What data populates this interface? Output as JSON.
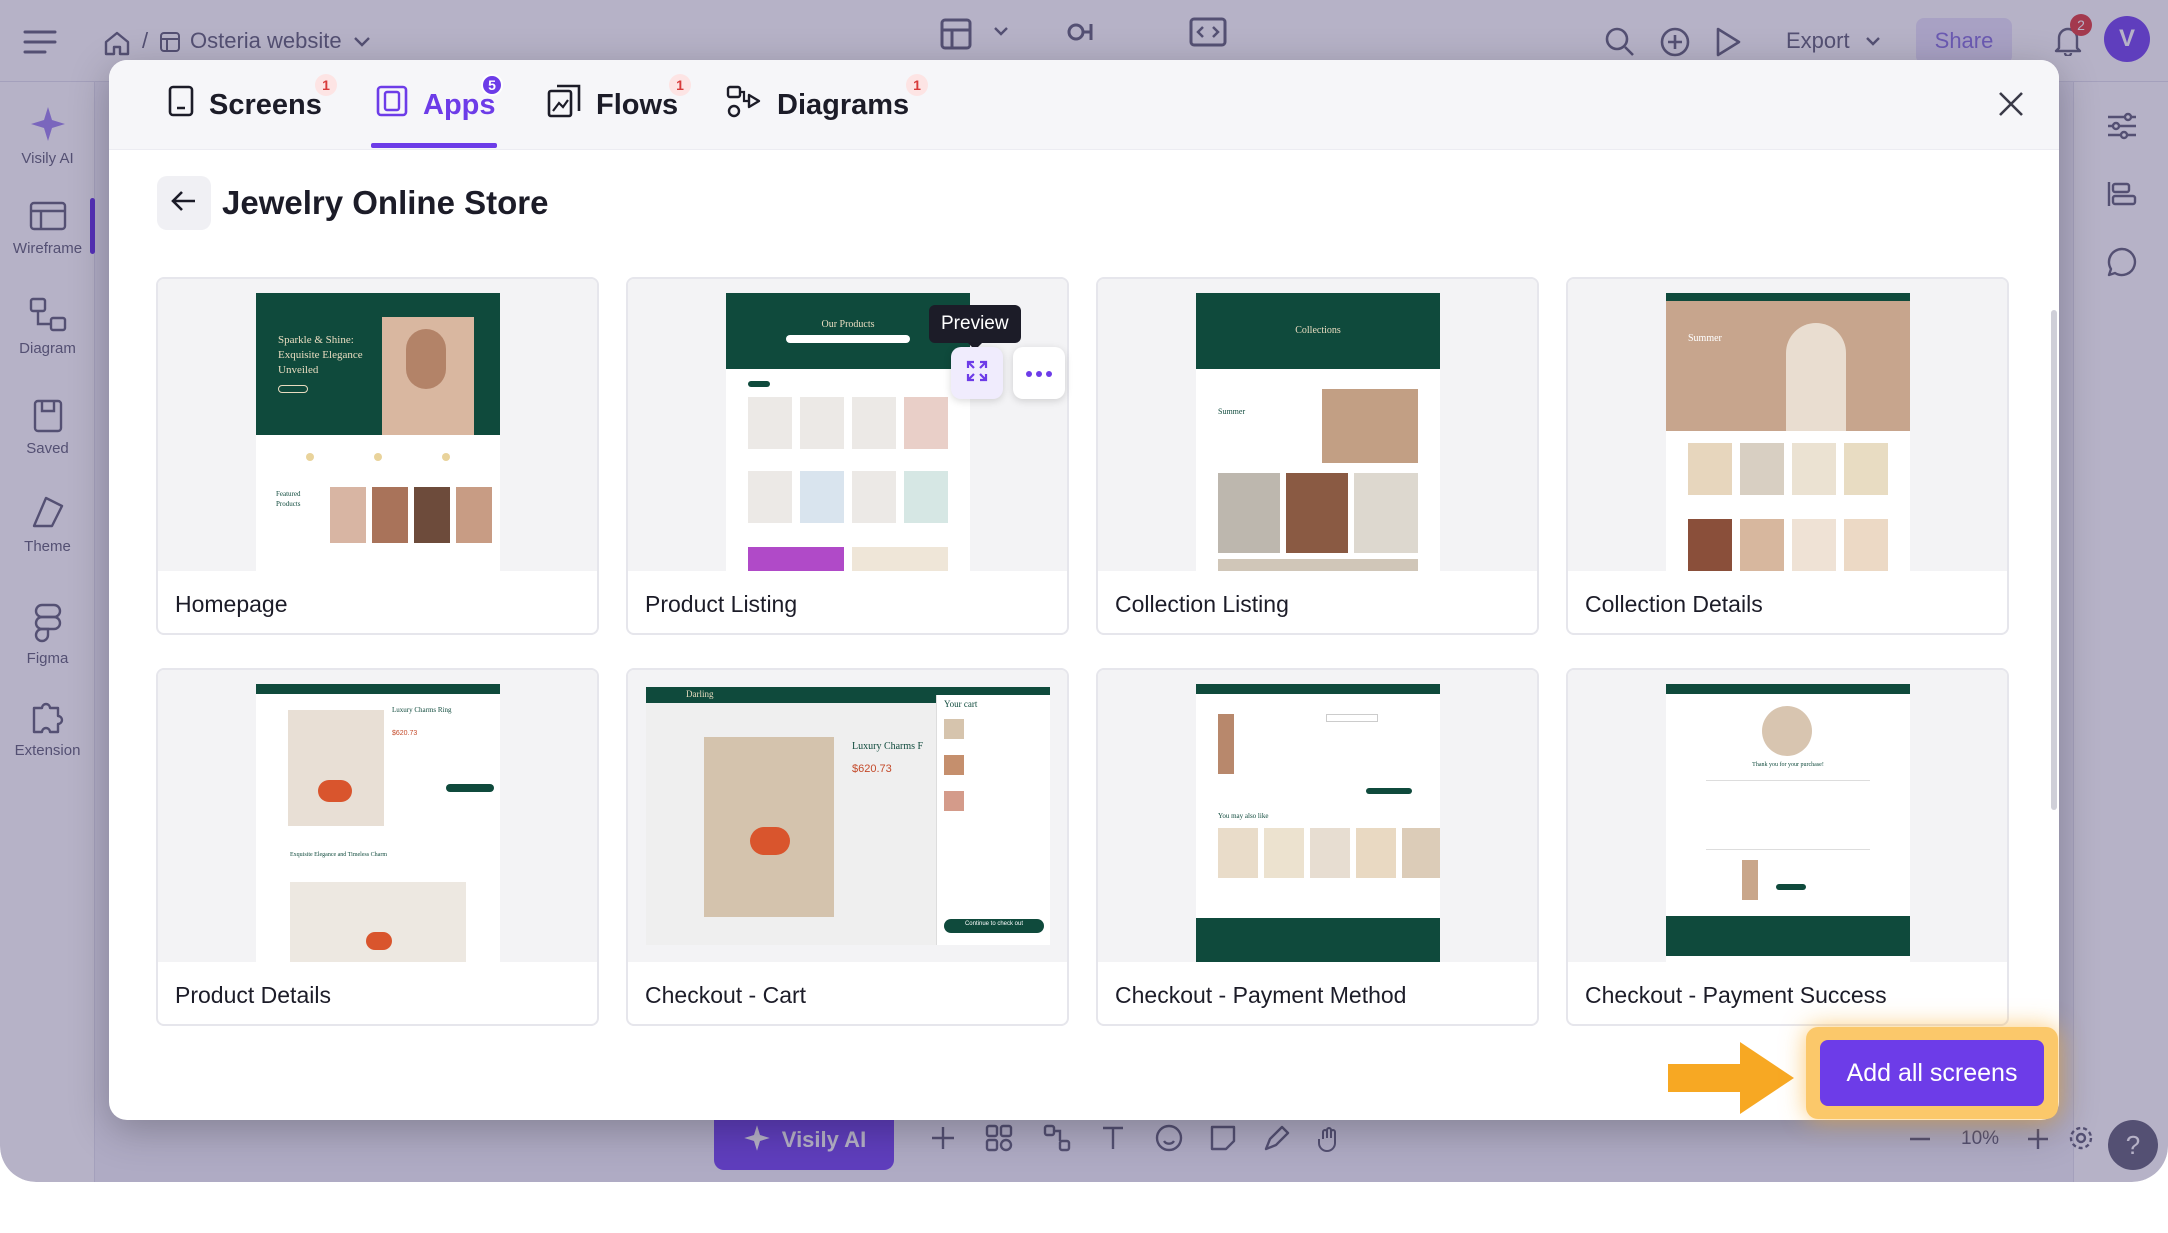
{
  "app": {
    "breadcrumb_project": "Osteria website",
    "export_label": "Export",
    "share_label": "Share",
    "notification_count": "2",
    "avatar_initial": "V"
  },
  "sidebar": {
    "items": [
      {
        "label": "Visily AI",
        "icon": "sparkle-icon"
      },
      {
        "label": "Wireframe",
        "icon": "wireframe-icon"
      },
      {
        "label": "Diagram",
        "icon": "diagram-icon"
      },
      {
        "label": "Saved",
        "icon": "saved-icon"
      },
      {
        "label": "Theme",
        "icon": "theme-icon"
      },
      {
        "label": "Figma",
        "icon": "figma-icon"
      },
      {
        "label": "Extension",
        "icon": "puzzle-icon"
      }
    ]
  },
  "bottombar": {
    "ai_label": "Visily AI",
    "zoom": "10%"
  },
  "modal": {
    "tabs": [
      {
        "label": "Screens",
        "badge": "1",
        "icon": "screen-icon"
      },
      {
        "label": "Apps",
        "badge": "5",
        "icon": "apps-icon"
      },
      {
        "label": "Flows",
        "badge": "1",
        "icon": "flows-icon"
      },
      {
        "label": "Diagrams",
        "badge": "1",
        "icon": "diagrams-icon"
      }
    ],
    "active_tab": "Apps",
    "title": "Jewelry Online Store",
    "tooltip": "Preview",
    "cards": [
      {
        "label": "Homepage",
        "hero_text": "Sparkle & Shine: Exquisite Elegance Unveiled",
        "sub_text": "Featured Products"
      },
      {
        "label": "Product Listing",
        "hero_text": "Our Products"
      },
      {
        "label": "Collection Listing",
        "hero_text": "Collections",
        "sub_text": "Summer"
      },
      {
        "label": "Collection Details",
        "hero_text": "Summer"
      },
      {
        "label": "Product Details",
        "hero_text": "Luxury Charms Ring",
        "price": "$620.73",
        "sub_text": "Exquisite Elegance and Timeless Charm"
      },
      {
        "label": "Checkout - Cart",
        "brand": "Darling",
        "hero_text": "Luxury Charms F",
        "price": "$620.73",
        "side_title": "Your cart",
        "cta": "Continue to check out"
      },
      {
        "label": "Checkout - Payment Method",
        "sub_text": "You may also like"
      },
      {
        "label": "Checkout - Payment Success",
        "hero_text": "Thank you for your purchase!"
      }
    ],
    "add_all_label": "Add all screens"
  },
  "colors": {
    "accent": "#6d3ce8",
    "brand_green": "#0f4a3c",
    "highlight": "#fbc86a",
    "arrow": "#f7a823"
  }
}
